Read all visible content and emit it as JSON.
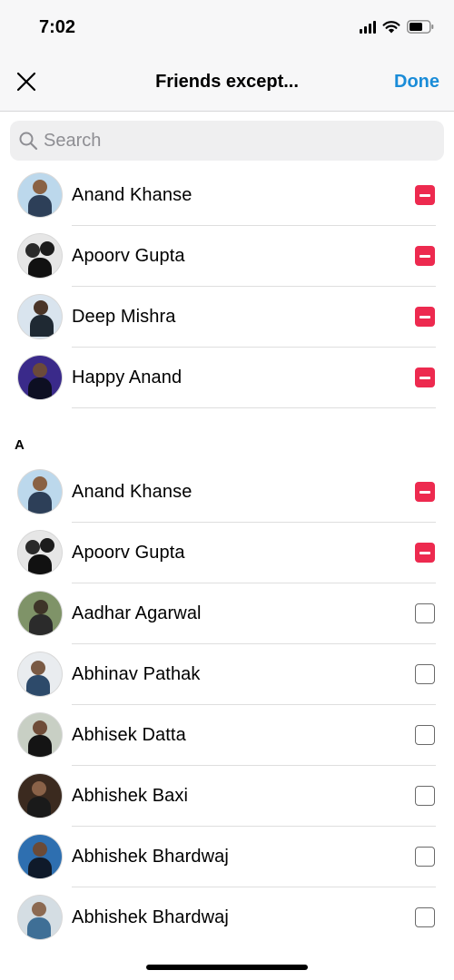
{
  "status": {
    "time": "7:02"
  },
  "nav": {
    "title": "Friends except...",
    "done_label": "Done"
  },
  "search": {
    "placeholder": "Search"
  },
  "selected": [
    {
      "name": "Anand Khanse",
      "checked": true
    },
    {
      "name": "Apoorv Gupta",
      "checked": true
    },
    {
      "name": "Deep Mishra",
      "checked": true
    },
    {
      "name": "Happy Anand",
      "checked": true
    }
  ],
  "section_a": {
    "header": "A",
    "friends": [
      {
        "name": "Anand Khanse",
        "checked": true
      },
      {
        "name": "Apoorv Gupta",
        "checked": true
      },
      {
        "name": "Aadhar Agarwal",
        "checked": false
      },
      {
        "name": "Abhinav Pathak",
        "checked": false
      },
      {
        "name": "Abhisek Datta",
        "checked": false
      },
      {
        "name": "Abhishek Baxi",
        "checked": false
      },
      {
        "name": "Abhishek Bhardwaj",
        "checked": false
      },
      {
        "name": "Abhishek Bhardwaj",
        "checked": false
      }
    ]
  },
  "colors": {
    "accent": "#1a8cd8",
    "checked": "#ed2a4f"
  }
}
